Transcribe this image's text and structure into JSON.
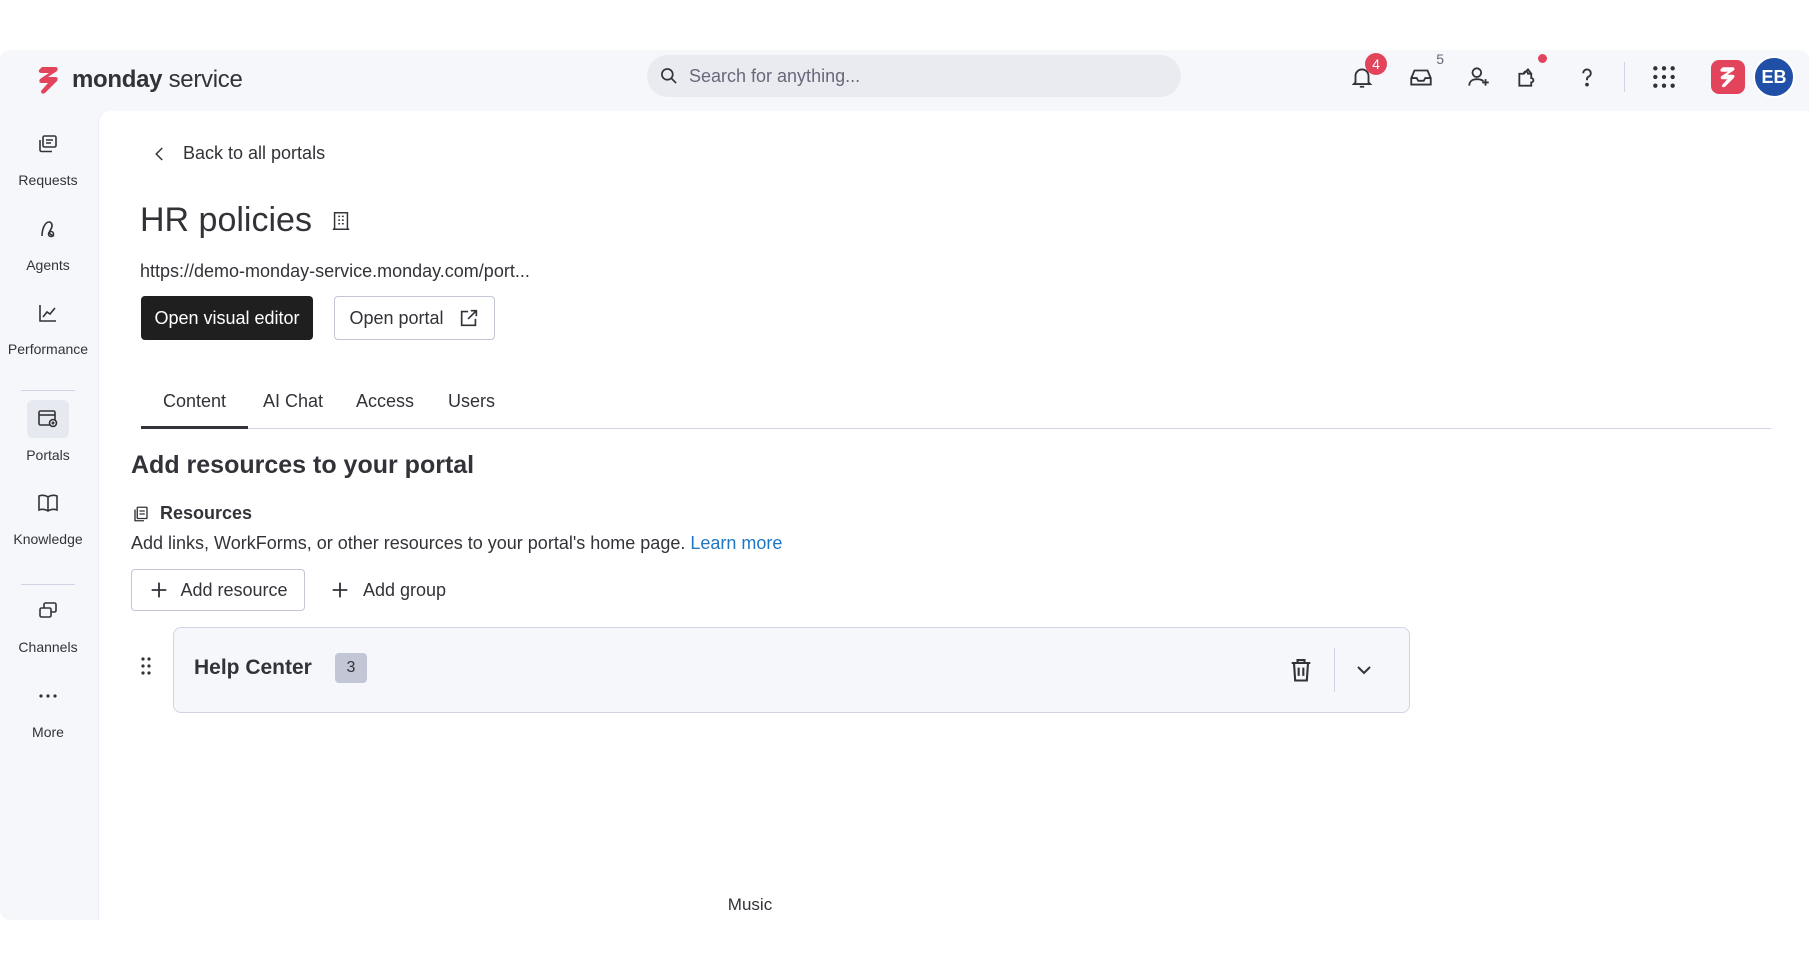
{
  "brand": {
    "name_bold": "monday",
    "name_light": "service",
    "color": "#e2445c"
  },
  "search": {
    "placeholder": "Search for anything..."
  },
  "topbar": {
    "notifications": {
      "icon": "bell-icon",
      "count": "4"
    },
    "inbox": {
      "icon": "inbox-icon",
      "count": "5"
    },
    "invite": {
      "icon": "add-user-icon"
    },
    "integrations": {
      "icon": "puzzle-icon"
    },
    "help": {
      "icon": "help-icon"
    },
    "apps": {
      "icon": "grid-icon"
    },
    "user_initials": "EB"
  },
  "sidebar": {
    "items": [
      {
        "label": "Requests",
        "icon": "requests-icon"
      },
      {
        "label": "Agents",
        "icon": "agents-icon"
      },
      {
        "label": "Performance",
        "icon": "performance-icon"
      },
      {
        "label": "Portals",
        "icon": "portals-icon",
        "active": true
      },
      {
        "label": "Knowledge",
        "icon": "book-icon"
      },
      {
        "label": "Channels",
        "icon": "channels-icon"
      },
      {
        "label": "More",
        "icon": "more-icon"
      }
    ]
  },
  "portal": {
    "back_label": "Back to all portals",
    "title": "HR policies",
    "url": "https://demo-monday-service.monday.com/port...",
    "open_editor_label": "Open visual editor",
    "open_portal_label": "Open portal"
  },
  "tabs": [
    {
      "label": "Content",
      "active": true
    },
    {
      "label": "AI Chat"
    },
    {
      "label": "Access"
    },
    {
      "label": "Users"
    }
  ],
  "content": {
    "heading": "Add resources to your portal",
    "resources_label": "Resources",
    "description": "Add links, WorkForms, or other resources to your portal's home page.",
    "learn_more": "Learn more",
    "add_resource_label": "Add resource",
    "add_group_label": "Add group",
    "groups": [
      {
        "name": "Help Center",
        "count": "3"
      }
    ]
  },
  "footer": {
    "music_label": "Music"
  }
}
